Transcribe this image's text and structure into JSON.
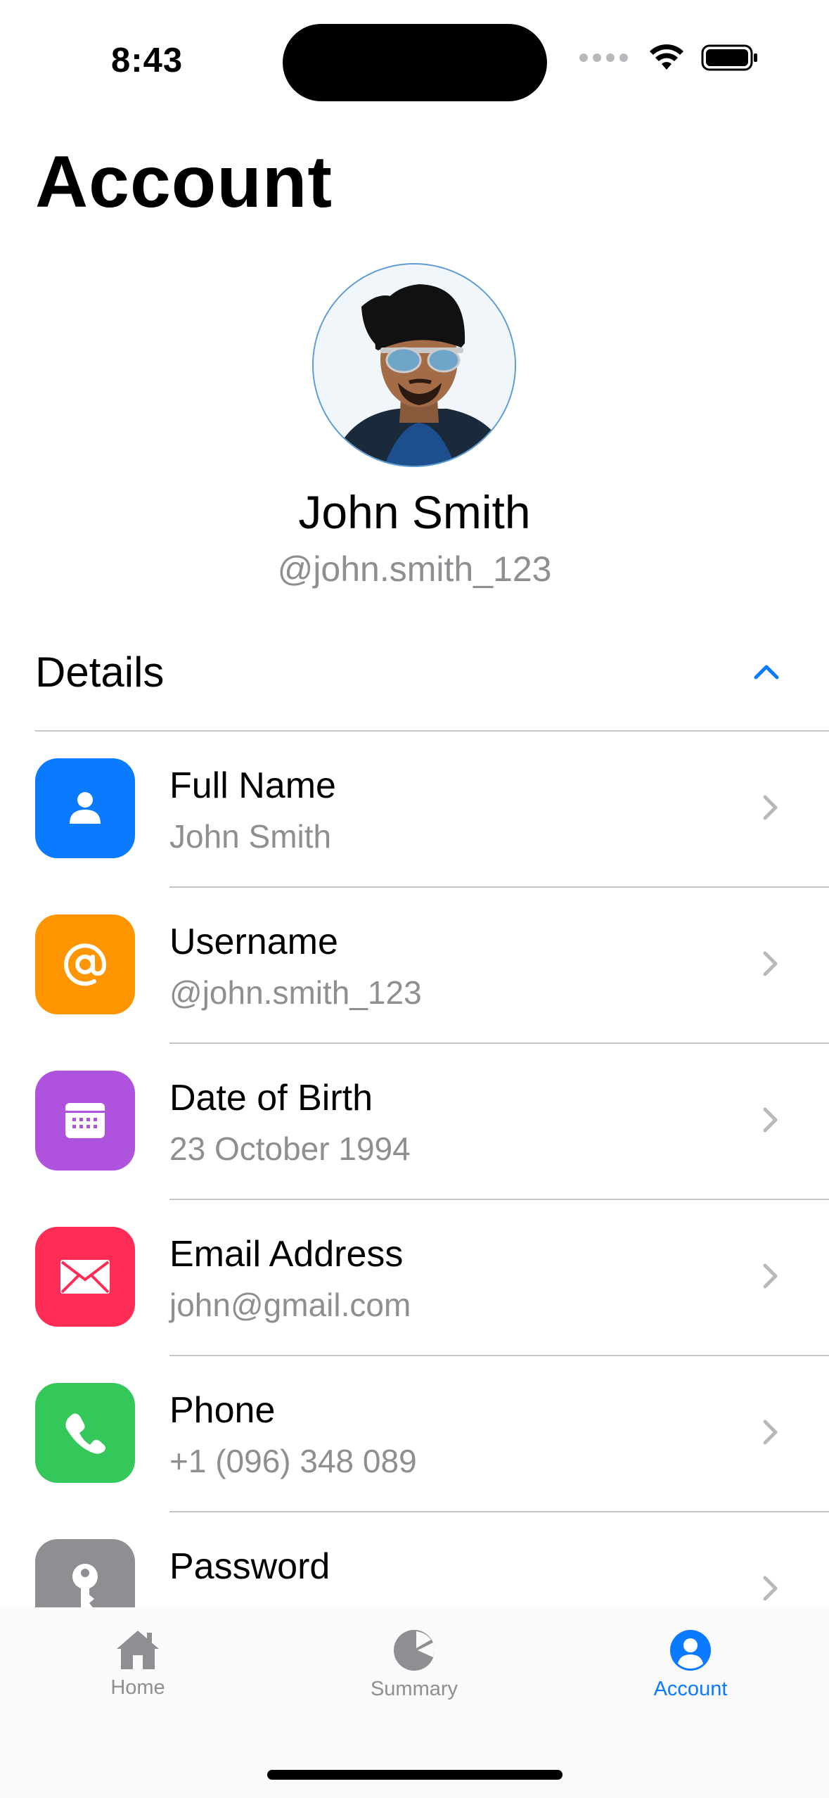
{
  "status": {
    "time": "8:43"
  },
  "page": {
    "title": "Account"
  },
  "profile": {
    "name": "John Smith",
    "handle": "@john.smith_123"
  },
  "details": {
    "section_title": "Details",
    "rows": [
      {
        "title": "Full Name",
        "value": "John Smith",
        "icon": "person-icon",
        "color": "#0A7AFF"
      },
      {
        "title": "Username",
        "value": "@john.smith_123",
        "icon": "at-sign-icon",
        "color": "#FF9500"
      },
      {
        "title": "Date of Birth",
        "value": "23 October 1994",
        "icon": "calendar-icon",
        "color": "#AF52DE"
      },
      {
        "title": "Email Address",
        "value": "john@gmail.com",
        "icon": "envelope-icon",
        "color": "#FF2D55"
      },
      {
        "title": "Phone",
        "value": "+1 (096) 348 089",
        "icon": "phone-icon",
        "color": "#34C759"
      },
      {
        "title": "Password",
        "value": "• • • • • • • • • •",
        "icon": "key-icon",
        "color": "#8E8E93"
      }
    ]
  },
  "tabs": [
    {
      "label": "Home",
      "icon": "house-icon",
      "active": false
    },
    {
      "label": "Summary",
      "icon": "pie-chart-icon",
      "active": false
    },
    {
      "label": "Account",
      "icon": "person-circle-icon",
      "active": true
    }
  ],
  "colors": {
    "accent": "#0A7AFF",
    "inactive_tab": "#8E8E93",
    "secondary_text": "#8E8E93"
  }
}
